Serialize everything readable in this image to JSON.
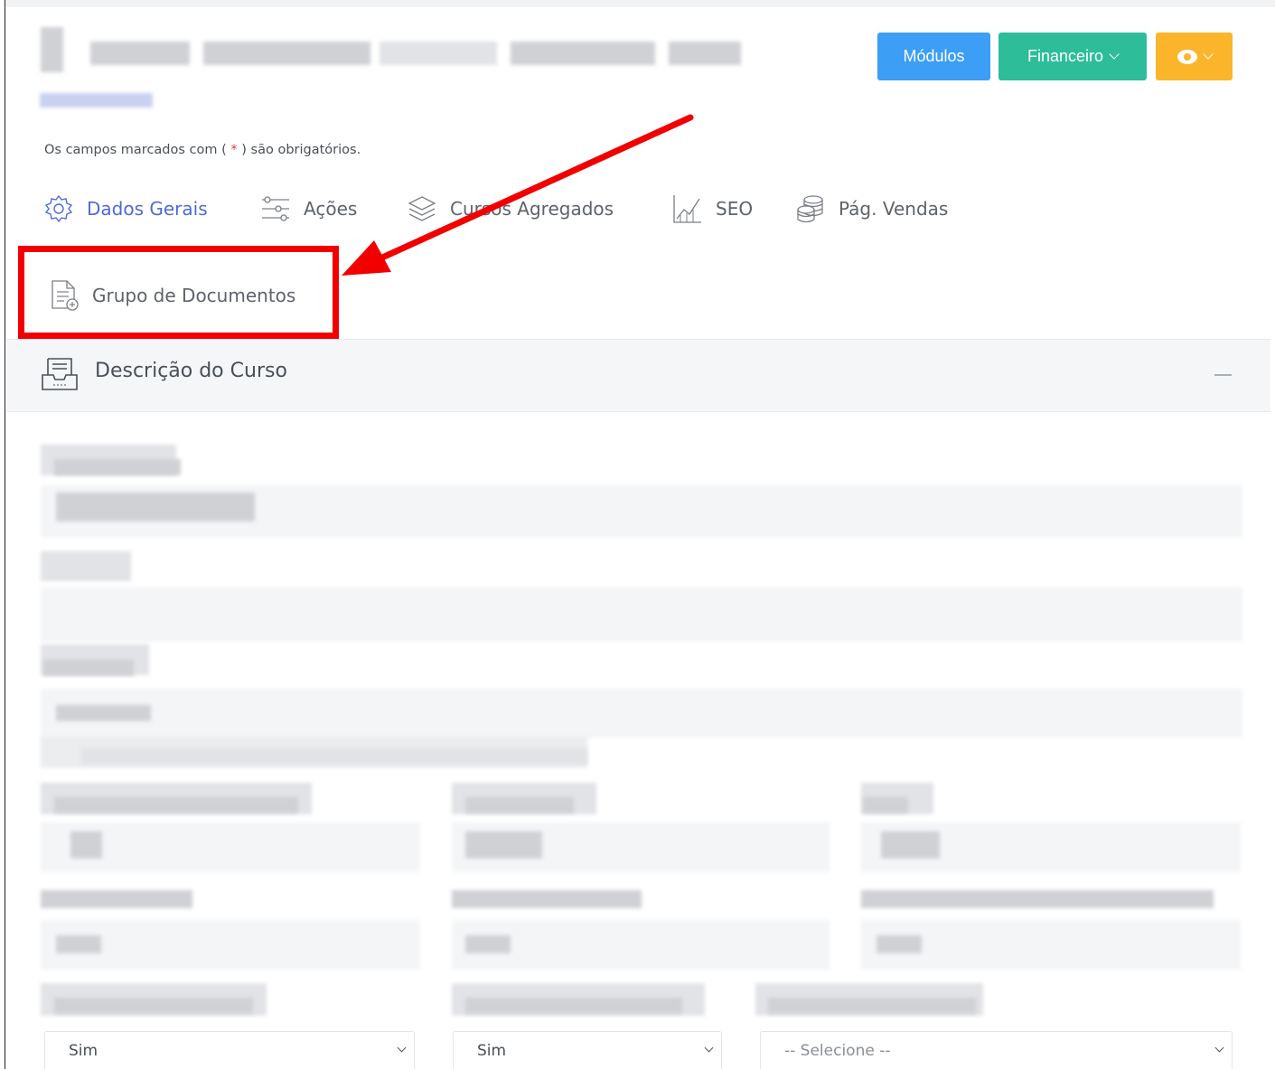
{
  "header": {
    "buttons": {
      "modulos": "Módulos",
      "financeiro": "Financeiro"
    }
  },
  "form": {
    "required_note_prefix": "Os campos marcados com (",
    "required_star": "*",
    "required_note_suffix": ") são obrigatórios."
  },
  "tabs": [
    {
      "label": "Dados Gerais",
      "icon": "gear-icon",
      "active": true
    },
    {
      "label": "Ações",
      "icon": "sliders-icon"
    },
    {
      "label": "Cursos Agregados",
      "icon": "layers-icon"
    },
    {
      "label": "SEO",
      "icon": "chart-icon"
    },
    {
      "label": "Pág. Vendas",
      "icon": "coins-icon"
    },
    {
      "label": "Grupo de Documentos",
      "icon": "document-icon"
    }
  ],
  "card": {
    "title": "Descrição do Curso",
    "icon": "inbox-icon"
  },
  "selects": [
    {
      "value": "Sim"
    },
    {
      "value": "Sim"
    },
    {
      "value": "-- Selecione --"
    }
  ],
  "colors": {
    "modulos": "#3c9ef5",
    "financeiro": "#2dbd99",
    "view": "#fbb52b",
    "active_tab": "#4f6ad8",
    "annotation": "#f20000"
  }
}
